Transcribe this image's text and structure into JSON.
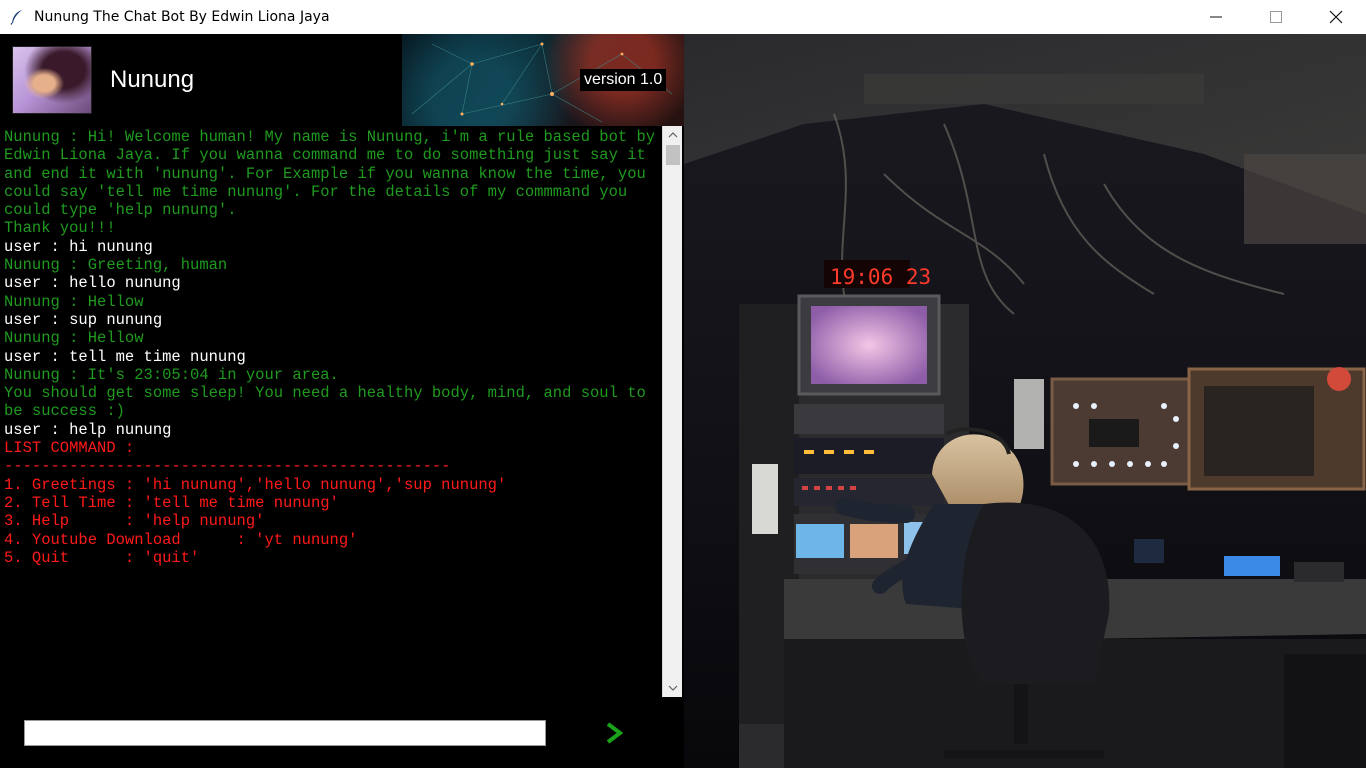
{
  "window": {
    "title": "Nunung The Chat Bot By Edwin Liona Jaya",
    "icon": "feather-icon",
    "controls": [
      "minimize-icon",
      "maximize-icon",
      "close-icon"
    ]
  },
  "header": {
    "bot_name": "Nunung",
    "version": "version 1.0"
  },
  "chat": {
    "messages": [
      {
        "color": "green",
        "text": "Nunung : Hi! Welcome human! My name is Nunung, i'm a rule based bot by Edwin Liona Jaya. If you wanna command me to do something just say it and end it with 'nunung'. For Example if you wanna know the time, you could say 'tell me time nunung'. For the details of my commmand you could type 'help nunung'.\nThank you!!!"
      },
      {
        "color": "white",
        "text": "user : hi nunung"
      },
      {
        "color": "green",
        "text": "Nunung : Greeting, human"
      },
      {
        "color": "white",
        "text": "user : hello nunung"
      },
      {
        "color": "green",
        "text": "Nunung : Hellow"
      },
      {
        "color": "white",
        "text": "user : sup nunung"
      },
      {
        "color": "green",
        "text": "Nunung : Hellow"
      },
      {
        "color": "white",
        "text": "user : tell me time nunung"
      },
      {
        "color": "green",
        "text": "Nunung : It's 23:05:04 in your area.\nYou should get some sleep! You need a healthy body, mind, and soul to be success :)"
      },
      {
        "color": "white",
        "text": "user : help nunung"
      },
      {
        "color": "red",
        "text": "LIST COMMAND :\n------------------------------------------------\n1. Greetings : 'hi nunung','hello nunung','sup nunung'\n2. Tell Time : 'tell me time nunung'\n3. Help      : 'help nunung'\n4. Youtube Download      : 'yt nunung'\n5. Quit      : 'quit'"
      }
    ]
  },
  "input": {
    "value": "",
    "send_icon": "chevron-right-icon"
  },
  "photo": {
    "clock_text": "19:06 23"
  },
  "colors": {
    "bot": "#1f9a1f",
    "user": "#ffffff",
    "command": "#ff1a1a",
    "send": "#1aa31a"
  }
}
